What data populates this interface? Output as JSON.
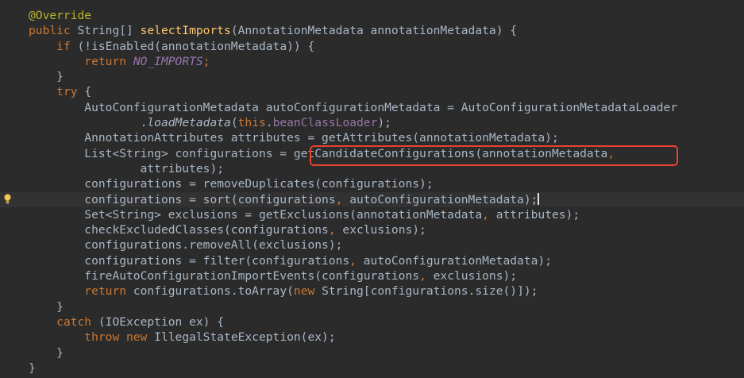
{
  "editor": {
    "theme_colors": {
      "background": "#2b2b2b",
      "keyword": "#cc7832",
      "method_declaration": "#ffc66d",
      "plain": "#a9b7c6",
      "annotation": "#bbb529",
      "constant": "#9876aa",
      "highlight_box": "#e8422c"
    },
    "gutter_icon": "lightbulb-icon",
    "lines": [
      {
        "indent": "",
        "tokens": [
          {
            "t": "@Override",
            "c": "an"
          }
        ]
      },
      {
        "indent": "",
        "tokens": [
          {
            "t": "public ",
            "c": "kw"
          },
          {
            "t": "String[] ",
            "c": "pl"
          },
          {
            "t": "selectImports",
            "c": "fn"
          },
          {
            "t": "(AnnotationMetadata annotationMetadata) {",
            "c": "pl"
          }
        ]
      },
      {
        "indent": "    ",
        "tokens": [
          {
            "t": "if ",
            "c": "kw"
          },
          {
            "t": "(!isEnabled(annotationMetadata)) {",
            "c": "pl"
          }
        ]
      },
      {
        "indent": "        ",
        "tokens": [
          {
            "t": "return ",
            "c": "kw"
          },
          {
            "t": "NO_IMPORTS",
            "c": "cn"
          },
          {
            "t": ";",
            "c": "kw"
          }
        ]
      },
      {
        "indent": "    ",
        "tokens": [
          {
            "t": "}",
            "c": "pl"
          }
        ]
      },
      {
        "indent": "    ",
        "tokens": [
          {
            "t": "try ",
            "c": "kw"
          },
          {
            "t": "{",
            "c": "pl"
          }
        ]
      },
      {
        "indent": "        ",
        "tokens": [
          {
            "t": "AutoConfigurationMetadata autoConfigurationMetadata = AutoConfigurationMetadataLoader",
            "c": "pl"
          }
        ]
      },
      {
        "indent": "                ",
        "tokens": [
          {
            "t": ".",
            "c": "pl"
          },
          {
            "t": "loadMetadata",
            "c": "it"
          },
          {
            "t": "(",
            "c": "pl"
          },
          {
            "t": "this",
            "c": "kw"
          },
          {
            "t": ".",
            "c": "pl"
          },
          {
            "t": "beanClassLoader",
            "c": "fd"
          },
          {
            "t": ");",
            "c": "pl"
          }
        ]
      },
      {
        "indent": "        ",
        "tokens": [
          {
            "t": "AnnotationAttributes attributes = getAttributes(annotationMetadata);",
            "c": "pl"
          }
        ]
      },
      {
        "indent": "        ",
        "tokens": [
          {
            "t": "List<String> configurations = getCandidateConfigurations(annotationMetadata",
            "c": "pl"
          },
          {
            "t": ",",
            "c": "kw"
          }
        ]
      },
      {
        "indent": "                ",
        "tokens": [
          {
            "t": "attributes);",
            "c": "pl"
          }
        ]
      },
      {
        "indent": "        ",
        "tokens": [
          {
            "t": "configurations = removeDuplicates(configurations);",
            "c": "pl"
          }
        ]
      },
      {
        "indent": "        ",
        "active": true,
        "caret": true,
        "bulb": true,
        "tokens": [
          {
            "t": "configurations = sort(configurations",
            "c": "pl"
          },
          {
            "t": ", ",
            "c": "kw"
          },
          {
            "t": "autoConfigurationMetadata);",
            "c": "pl"
          }
        ]
      },
      {
        "indent": "        ",
        "tokens": [
          {
            "t": "Set<String> exclusions = getExclusions(annotationMetadata",
            "c": "pl"
          },
          {
            "t": ", ",
            "c": "kw"
          },
          {
            "t": "attributes);",
            "c": "pl"
          }
        ]
      },
      {
        "indent": "        ",
        "tokens": [
          {
            "t": "checkExcludedClasses(configurations",
            "c": "pl"
          },
          {
            "t": ", ",
            "c": "kw"
          },
          {
            "t": "exclusions);",
            "c": "pl"
          }
        ]
      },
      {
        "indent": "        ",
        "tokens": [
          {
            "t": "configurations.removeAll(exclusions);",
            "c": "pl"
          }
        ]
      },
      {
        "indent": "        ",
        "tokens": [
          {
            "t": "configurations = filter(configurations",
            "c": "pl"
          },
          {
            "t": ", ",
            "c": "kw"
          },
          {
            "t": "autoConfigurationMetadata);",
            "c": "pl"
          }
        ]
      },
      {
        "indent": "        ",
        "tokens": [
          {
            "t": "fireAutoConfigurationImportEvents(configurations",
            "c": "pl"
          },
          {
            "t": ", ",
            "c": "kw"
          },
          {
            "t": "exclusions);",
            "c": "pl"
          }
        ]
      },
      {
        "indent": "        ",
        "tokens": [
          {
            "t": "return ",
            "c": "kw"
          },
          {
            "t": "configurations.toArray(",
            "c": "pl"
          },
          {
            "t": "new ",
            "c": "kw"
          },
          {
            "t": "String[configurations.size()]);",
            "c": "pl"
          }
        ]
      },
      {
        "indent": "    ",
        "tokens": [
          {
            "t": "}",
            "c": "pl"
          }
        ]
      },
      {
        "indent": "    ",
        "tokens": [
          {
            "t": "catch ",
            "c": "kw"
          },
          {
            "t": "(IOException ex) {",
            "c": "pl"
          }
        ]
      },
      {
        "indent": "        ",
        "tokens": [
          {
            "t": "throw new ",
            "c": "kw"
          },
          {
            "t": "IllegalStateException(ex);",
            "c": "pl"
          }
        ]
      },
      {
        "indent": "    ",
        "tokens": [
          {
            "t": "}",
            "c": "pl"
          }
        ]
      },
      {
        "indent": "",
        "tokens": [
          {
            "t": "}",
            "c": "pl"
          }
        ]
      }
    ]
  }
}
